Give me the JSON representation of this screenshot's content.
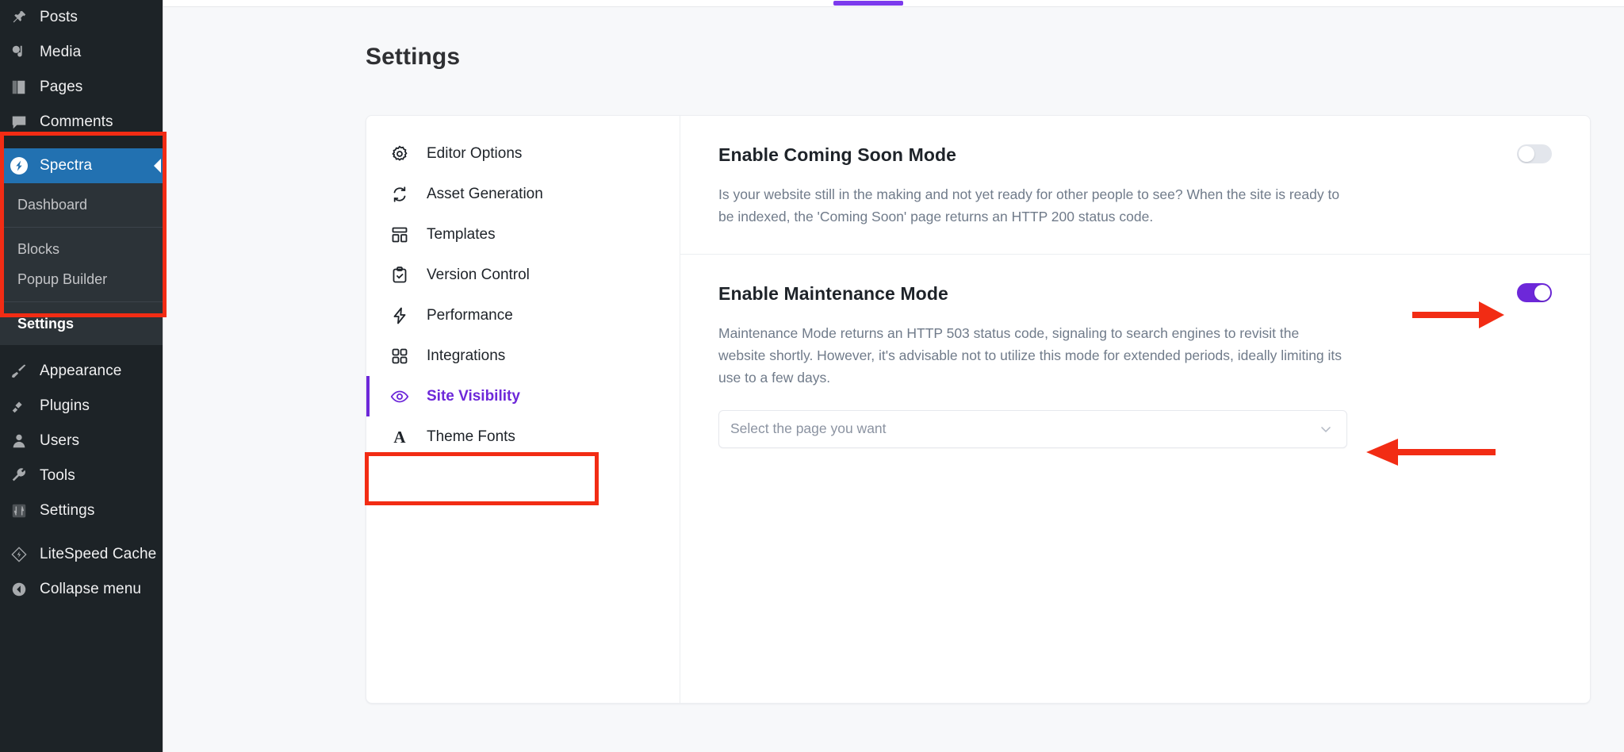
{
  "wp_sidebar": {
    "items": [
      {
        "label": "Posts",
        "icon": "pin-icon"
      },
      {
        "label": "Media",
        "icon": "media-icon"
      },
      {
        "label": "Pages",
        "icon": "pages-icon"
      },
      {
        "label": "Comments",
        "icon": "comment-icon"
      }
    ],
    "current_item": {
      "label": "Spectra",
      "icon": "spectra-logo-icon"
    },
    "submenu_groups": [
      {
        "items": [
          {
            "label": "Dashboard",
            "active": false
          }
        ]
      },
      {
        "items": [
          {
            "label": "Blocks",
            "active": false
          },
          {
            "label": "Popup Builder",
            "active": false
          }
        ]
      },
      {
        "items": [
          {
            "label": "Settings",
            "active": true
          }
        ]
      }
    ],
    "items_after": [
      {
        "label": "Appearance",
        "icon": "paintbrush-icon"
      },
      {
        "label": "Plugins",
        "icon": "plug-icon"
      },
      {
        "label": "Users",
        "icon": "user-icon"
      },
      {
        "label": "Tools",
        "icon": "wrench-icon"
      },
      {
        "label": "Settings",
        "icon": "sliders-icon"
      }
    ],
    "items_tail": [
      {
        "label": "LiteSpeed Cache",
        "icon": "litespeed-icon"
      },
      {
        "label": "Collapse menu",
        "icon": "collapse-arrow-icon"
      }
    ]
  },
  "page": {
    "title": "Settings"
  },
  "settings_nav": [
    {
      "label": "Editor Options",
      "icon": "gear-icon",
      "active": false
    },
    {
      "label": "Asset Generation",
      "icon": "refresh-icon",
      "active": false
    },
    {
      "label": "Templates",
      "icon": "layout-icon",
      "active": false
    },
    {
      "label": "Version Control",
      "icon": "clipboard-check-icon",
      "active": false
    },
    {
      "label": "Performance",
      "icon": "lightning-icon",
      "active": false
    },
    {
      "label": "Integrations",
      "icon": "grid-dots-icon",
      "active": false
    },
    {
      "label": "Site Visibility",
      "icon": "eye-icon",
      "active": true
    },
    {
      "label": "Theme Fonts",
      "icon": "letter-a-icon",
      "active": false
    }
  ],
  "sections": [
    {
      "title": "Enable Coming Soon Mode",
      "description": "Is your website still in the making and not yet ready for other people to see? When the site is ready to be indexed, the 'Coming Soon' page returns an HTTP 200 status code.",
      "toggle_state": "off"
    },
    {
      "title": "Enable Maintenance Mode",
      "description": "Maintenance Mode returns an HTTP 503 status code, signaling to search engines to revisit the website shortly. However, it's advisable not to utilize this mode for extended periods, ideally limiting its use to a few days.",
      "toggle_state": "on",
      "select_placeholder": "Select the page you want"
    }
  ],
  "annotations": {
    "highlight_boxes": [
      "spectra-menu-group",
      "site-visibility-nav-item"
    ],
    "arrows": [
      "arrow-to-maintenance-toggle",
      "arrow-to-page-select"
    ],
    "color": "#f22c14"
  },
  "colors": {
    "accent_purple": "#6d28d9",
    "wp_blue": "#2271b1",
    "annotation_red": "#f22c14"
  }
}
